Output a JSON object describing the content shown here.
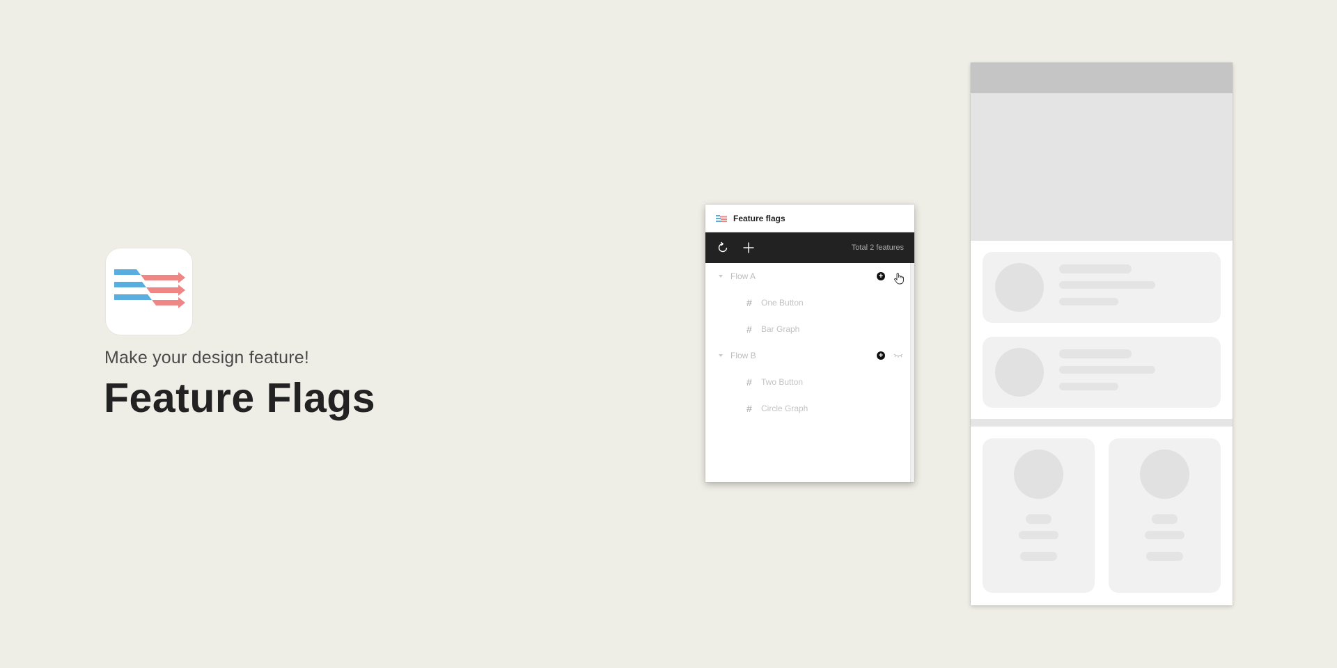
{
  "hero": {
    "tagline": "Make your design feature!",
    "title": "Feature Flags",
    "logo_icon": "feature-flags-logo-icon"
  },
  "plugin": {
    "title": "Feature flags",
    "toolbar": {
      "refresh_icon": "refresh-icon",
      "add_icon": "plus-icon",
      "total_text": "Total 2 features"
    },
    "flows": [
      {
        "label": "Flow A",
        "frames": [
          "One Button",
          "Bar Graph"
        ]
      },
      {
        "label": "Flow B",
        "frames": [
          "Two Button",
          "Circle Graph"
        ]
      }
    ],
    "flow_add_badge": "+",
    "frame_glyph": "#"
  },
  "colors": {
    "background": "#efeee6",
    "toolbar": "#222222",
    "logo_blue": "#5aaedf",
    "logo_red": "#ef8686"
  }
}
